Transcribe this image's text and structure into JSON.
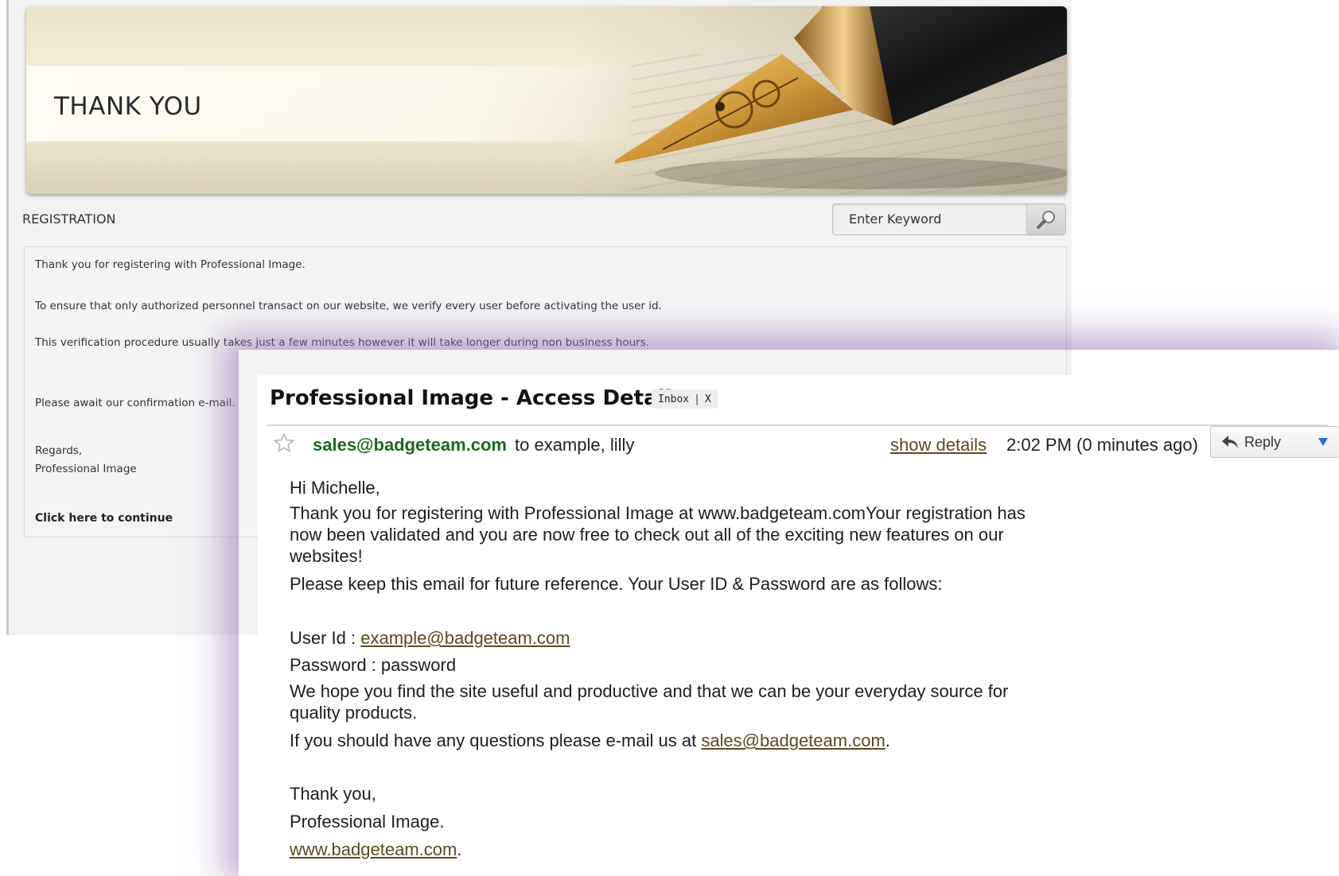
{
  "site": {
    "banner_title": "THANK YOU",
    "section_label": "REGISTRATION",
    "search": {
      "placeholder": "Enter Keyword"
    },
    "messages": {
      "line1": "Thank you for registering with Professional Image.",
      "line2": "To ensure that only authorized personnel transact on our website, we verify every user before activating the user id.",
      "line3": "This verification procedure usually takes just a few minutes however it will take longer during non business hours.",
      "line4": "Please await our confirmation e-mail.",
      "regards": "Regards,",
      "signature": "Professional Image",
      "continue_link": "Click here to continue"
    }
  },
  "email": {
    "subject": "Professional Image - Access Details",
    "label": "Inbox",
    "label_remove": "X",
    "sender": "sales@badgeteam.com",
    "recipients": "to example, lilly",
    "show_details": "show details",
    "time": "2:02 PM (0 minutes ago)",
    "reply_label": "Reply",
    "body": {
      "greeting": "Hi Michelle,",
      "para1_line1": "Thank you for registering with Professional Image at www.badgeteam.comYour registration has",
      "para1_line2": "now been validated and you are now free to check out all of the exciting new features on our",
      "para1_line3": "websites!",
      "para2": "Please keep this email for future reference. Your User ID & Password are as follows:",
      "user_id_label": "User Id : ",
      "user_id_value": "example@badgeteam.com",
      "password_line": "Password : password",
      "para3_line1": "We hope you find the site useful and productive and that we can be your everyday source for",
      "para3_line2": "quality products.",
      "para4_prefix": "If you should have any questions please e-mail us at ",
      "para4_link": "sales@badgeteam.com",
      "para4_suffix": ".",
      "closing1": "Thank you,",
      "closing2": "Professional Image.",
      "closing_link": "www.badgeteam.com",
      "closing_suffix": "."
    }
  },
  "colors": {
    "sender_green": "#1a6b1a",
    "link_brown": "#5a4a22",
    "glow_purple": "#9a6eb4"
  },
  "icons": [
    "pen-image",
    "magnifier-icon",
    "star-icon",
    "reply-arrow-icon",
    "dropdown-arrow-icon"
  ]
}
